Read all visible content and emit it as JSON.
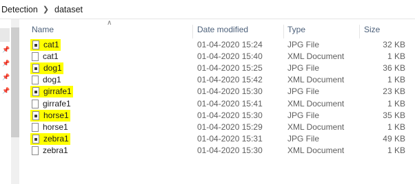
{
  "breadcrumb": {
    "parent": "Detection",
    "current": "dataset"
  },
  "columns": {
    "name": "Name",
    "date": "Date modified",
    "type": "Type",
    "size": "Size"
  },
  "files": [
    {
      "name": "cat1",
      "date": "01-04-2020 15:24",
      "type": "JPG File",
      "size": "32 KB",
      "kind": "jpg",
      "highlighted": true
    },
    {
      "name": "cat1",
      "date": "01-04-2020 15:40",
      "type": "XML Document",
      "size": "1 KB",
      "kind": "xml",
      "highlighted": false
    },
    {
      "name": "dog1",
      "date": "01-04-2020 15:25",
      "type": "JPG File",
      "size": "36 KB",
      "kind": "jpg",
      "highlighted": true
    },
    {
      "name": "dog1",
      "date": "01-04-2020 15:42",
      "type": "XML Document",
      "size": "1 KB",
      "kind": "xml",
      "highlighted": false
    },
    {
      "name": "girrafe1",
      "date": "01-04-2020 15:30",
      "type": "JPG File",
      "size": "23 KB",
      "kind": "jpg",
      "highlighted": true
    },
    {
      "name": "girrafe1",
      "date": "01-04-2020 15:41",
      "type": "XML Document",
      "size": "1 KB",
      "kind": "xml",
      "highlighted": false
    },
    {
      "name": "horse1",
      "date": "01-04-2020 15:30",
      "type": "JPG File",
      "size": "35 KB",
      "kind": "jpg",
      "highlighted": true
    },
    {
      "name": "horse1",
      "date": "01-04-2020 15:29",
      "type": "XML Document",
      "size": "1 KB",
      "kind": "xml",
      "highlighted": false
    },
    {
      "name": "zebra1",
      "date": "01-04-2020 15:31",
      "type": "JPG File",
      "size": "49 KB",
      "kind": "jpg",
      "highlighted": true
    },
    {
      "name": "zebra1",
      "date": "01-04-2020 15:30",
      "type": "XML Document",
      "size": "1 KB",
      "kind": "xml",
      "highlighted": false
    }
  ],
  "colors": {
    "highlight": "#ffff00",
    "header_text": "#4c607a"
  }
}
